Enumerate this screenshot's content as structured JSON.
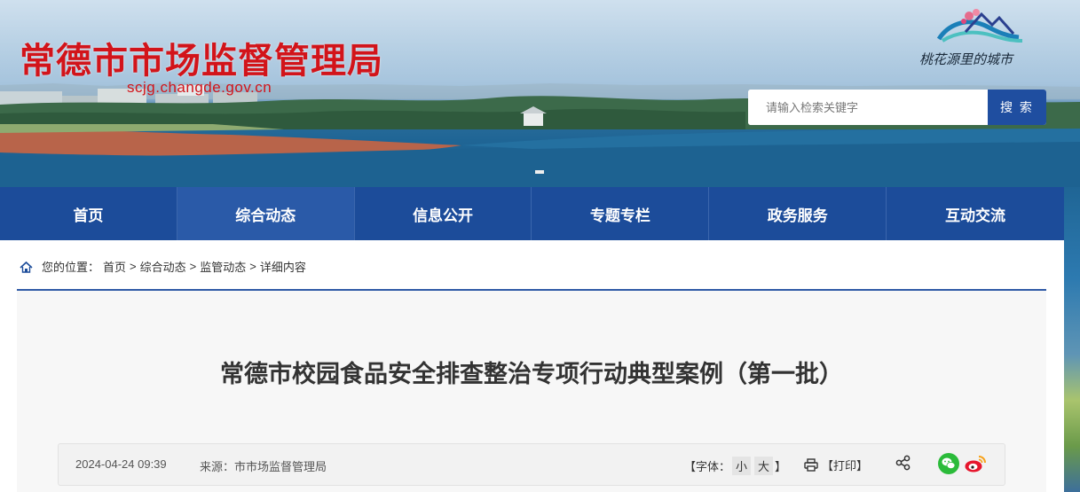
{
  "header": {
    "site_title": "常德市市场监督管理局",
    "site_domain": "scjg.changde.gov.cn",
    "slogan": "桃花源里的城市",
    "search": {
      "placeholder": "请输入检索关键字",
      "button_label": "搜 索"
    }
  },
  "nav": {
    "items": [
      {
        "label": "首页"
      },
      {
        "label": "综合动态"
      },
      {
        "label": "信息公开"
      },
      {
        "label": "专题专栏"
      },
      {
        "label": "政务服务"
      },
      {
        "label": "互动交流"
      }
    ]
  },
  "breadcrumb": {
    "prefix": "您的位置：",
    "items": [
      "首页",
      "综合动态",
      "监管动态",
      "详细内容"
    ],
    "separator": ">"
  },
  "article": {
    "title": "常德市校园食品安全排查整治专项行动典型案例（第一批）",
    "date": "2024-04-24 09:39",
    "source_label": "来源：",
    "source": "市市场监督管理局",
    "font_label": "【字体：",
    "font_small": "小",
    "font_large": "大",
    "font_close": "】",
    "print_label": "【打印】"
  },
  "colors": {
    "brand_red": "#d2141a",
    "nav_blue": "#1c4c9a",
    "divider_blue": "#2f5aa6",
    "wechat_green": "#2bbb3a",
    "weibo_red": "#e6162d"
  }
}
